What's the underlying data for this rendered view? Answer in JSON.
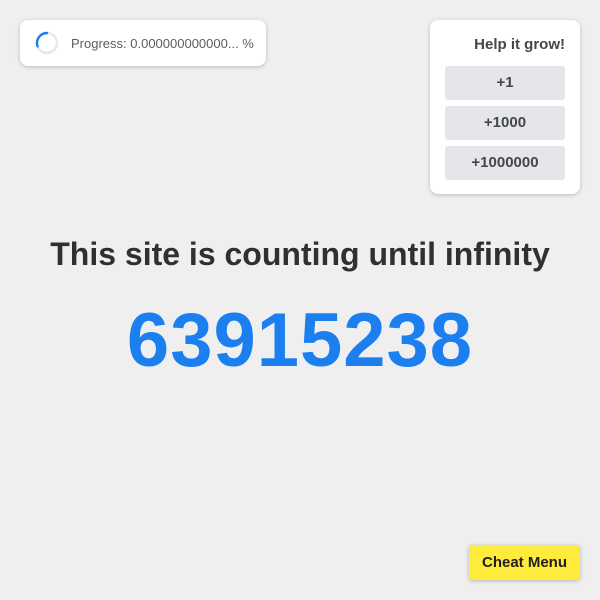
{
  "progress": {
    "icon": "loading-spinner-icon",
    "text": "Progress: 0.000000000000... %"
  },
  "help": {
    "title": "Help it grow!",
    "buttons": [
      "+1",
      "+1000",
      "+1000000"
    ]
  },
  "main": {
    "headline": "This site is counting until infinity",
    "counter": "63915238"
  },
  "cheat": {
    "label": "Cheat Menu"
  },
  "colors": {
    "background": "#efeff0",
    "counter": "#1c7ff0",
    "cheat_button": "#ffeb3b",
    "help_button": "#e4e6ea",
    "spinner": "#1c7ff0"
  }
}
